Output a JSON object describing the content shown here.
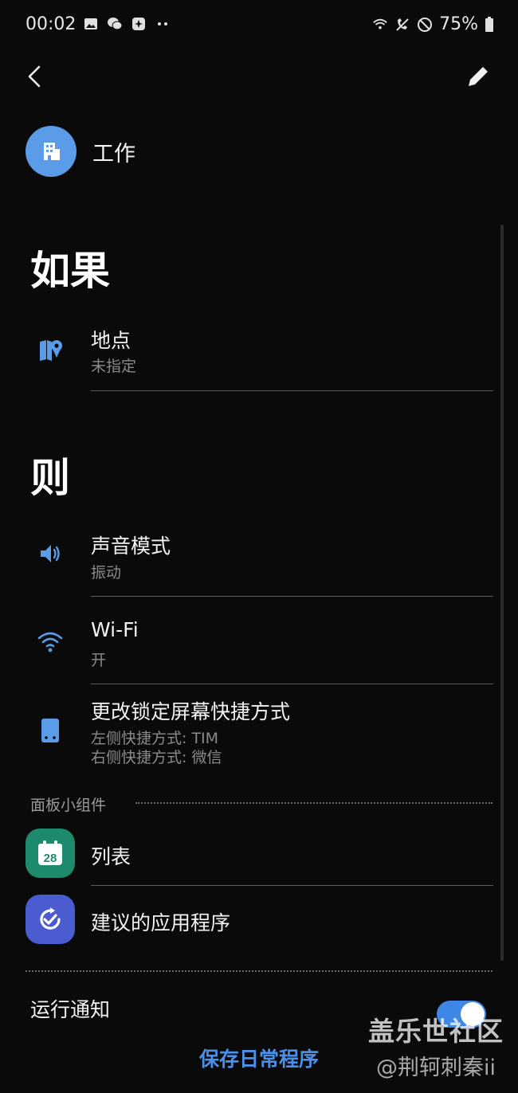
{
  "status_bar": {
    "time": "00:02",
    "battery": "75%",
    "left_icons": [
      "gallery-icon",
      "wechat-icon",
      "notification-icon",
      "more-dots-icon"
    ],
    "right_icons": [
      "wifi-calling-icon",
      "call-forward-icon",
      "do-not-disturb-icon",
      "battery-icon"
    ]
  },
  "topbar": {
    "back_icon": "chevron-left-icon",
    "edit_icon": "pencil-icon"
  },
  "routine": {
    "name": "工作",
    "icon": "building-icon",
    "icon_color": "#5b9ce8"
  },
  "if_section": {
    "title": "如果",
    "items": [
      {
        "title": "地点",
        "subtitle": "未指定",
        "icon": "map-pin-icon"
      }
    ]
  },
  "then_section": {
    "title": "则",
    "items": [
      {
        "title": "声音模式",
        "subtitle": "振动",
        "icon": "speaker-icon"
      },
      {
        "title": "Wi-Fi",
        "subtitle": "开",
        "icon": "wifi-icon"
      },
      {
        "title": "更改锁定屏幕快捷方式",
        "subtitle_1": "左侧快捷方式: TIM",
        "subtitle_2": "右侧快捷方式: 微信",
        "icon": "phone-icon"
      }
    ]
  },
  "widgets": {
    "label": "面板小组件",
    "items": [
      {
        "title": "列表",
        "icon": "calendar-icon",
        "icon_text": "28",
        "icon_color": "#1d8a6e"
      },
      {
        "title": "建议的应用程序",
        "icon": "suggested-apps-icon",
        "icon_color": "#4a5ccf"
      }
    ]
  },
  "notification": {
    "label": "运行通知",
    "toggle_on": true
  },
  "save_button": "保存日常程序",
  "watermark": {
    "line1": "盖乐世社区",
    "line2": "@荆轲刺秦ii"
  },
  "colors": {
    "accent": "#3e87e6",
    "icon_blue": "#5b9ce8",
    "background": "#0a0a0a"
  }
}
